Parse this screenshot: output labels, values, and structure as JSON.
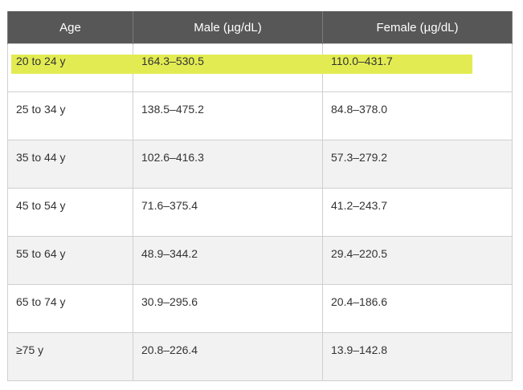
{
  "table": {
    "headers": [
      "Age",
      "Male (µg/dL)",
      "Female (µg/dL)"
    ],
    "rows": [
      [
        "20 to 24 y",
        "164.3–530.5",
        "110.0–431.7"
      ],
      [
        "25 to 34 y",
        "138.5–475.2",
        "84.8–378.0"
      ],
      [
        "35 to 44 y",
        "102.6–416.3",
        "57.3–279.2"
      ],
      [
        "45 to 54 y",
        "71.6–375.4",
        "41.2–243.7"
      ],
      [
        "55 to 64 y",
        "48.9–344.2",
        "29.4–220.5"
      ],
      [
        "65 to 74 y",
        "30.9–295.6",
        "20.4–186.6"
      ],
      [
        "≥75 y",
        "20.8–226.4",
        "13.9–142.8"
      ]
    ],
    "highlighted_row": 0
  },
  "colors": {
    "header_bg": "#575757",
    "highlight": "#e2ec52",
    "stripe": "#f2f2f2"
  }
}
